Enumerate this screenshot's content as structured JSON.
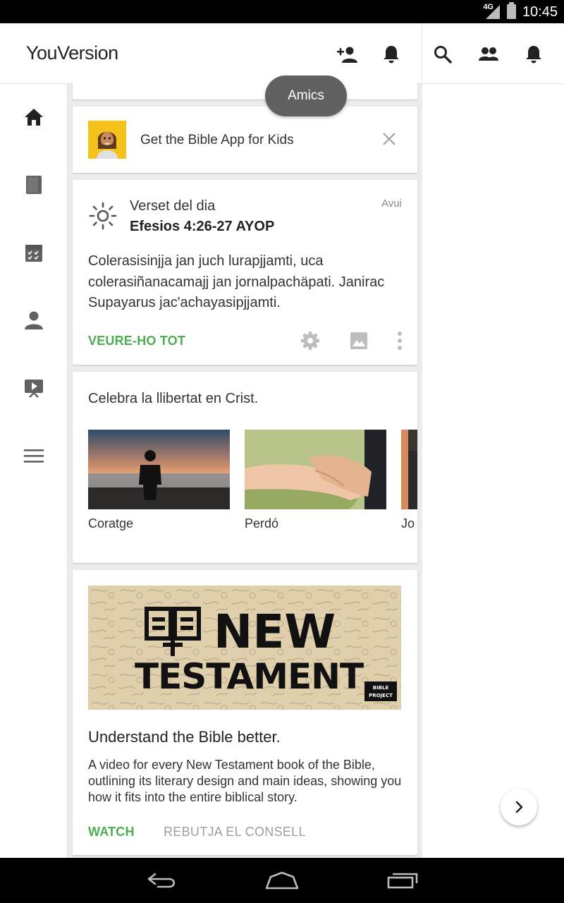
{
  "status_bar": {
    "network": "4G",
    "time": "10:45"
  },
  "app_bar": {
    "logo": "YouVersion",
    "icons": [
      "add-friend-icon",
      "notifications-icon",
      "search-icon",
      "friends-icon",
      "notifications-icon"
    ]
  },
  "tooltip": "Amics",
  "left_nav": [
    "home-icon",
    "bible-icon",
    "plans-icon",
    "profile-icon",
    "videos-icon",
    "menu-icon"
  ],
  "kids_card": {
    "text": "Get the Bible App for Kids"
  },
  "votd": {
    "label": "Verset del dia",
    "reference": "Efesios 4:26-27 AYOP",
    "date": "Avui",
    "text": "Colerasisinjja jan juch lurapjjamti, uca colerasiñanacamajj jan jornalpachäpati. Janirac Supayarus jac'achayasipjjamti.",
    "see_all": "VEURE-HO TOT"
  },
  "plans": {
    "title": "Celebra la llibertat en Crist.",
    "items": [
      {
        "label": "Coratge"
      },
      {
        "label": "Perdó"
      },
      {
        "label": "Jo"
      }
    ]
  },
  "nt_card": {
    "banner_line1": "NEW",
    "banner_line2": "TESTAMENT",
    "banner_badge_line1": "BIBLE",
    "banner_badge_line2": "PROJECT",
    "title": "Understand the Bible better.",
    "description": "A video for every New Testament book of the Bible, outlining its literary design and main ideas, showing you how it fits into the entire biblical story.",
    "watch": "WATCH",
    "dismiss": "REBUTJA EL CONSELL"
  },
  "colors": {
    "accent_green": "#4caf50",
    "tooltip_bg": "#616161"
  }
}
